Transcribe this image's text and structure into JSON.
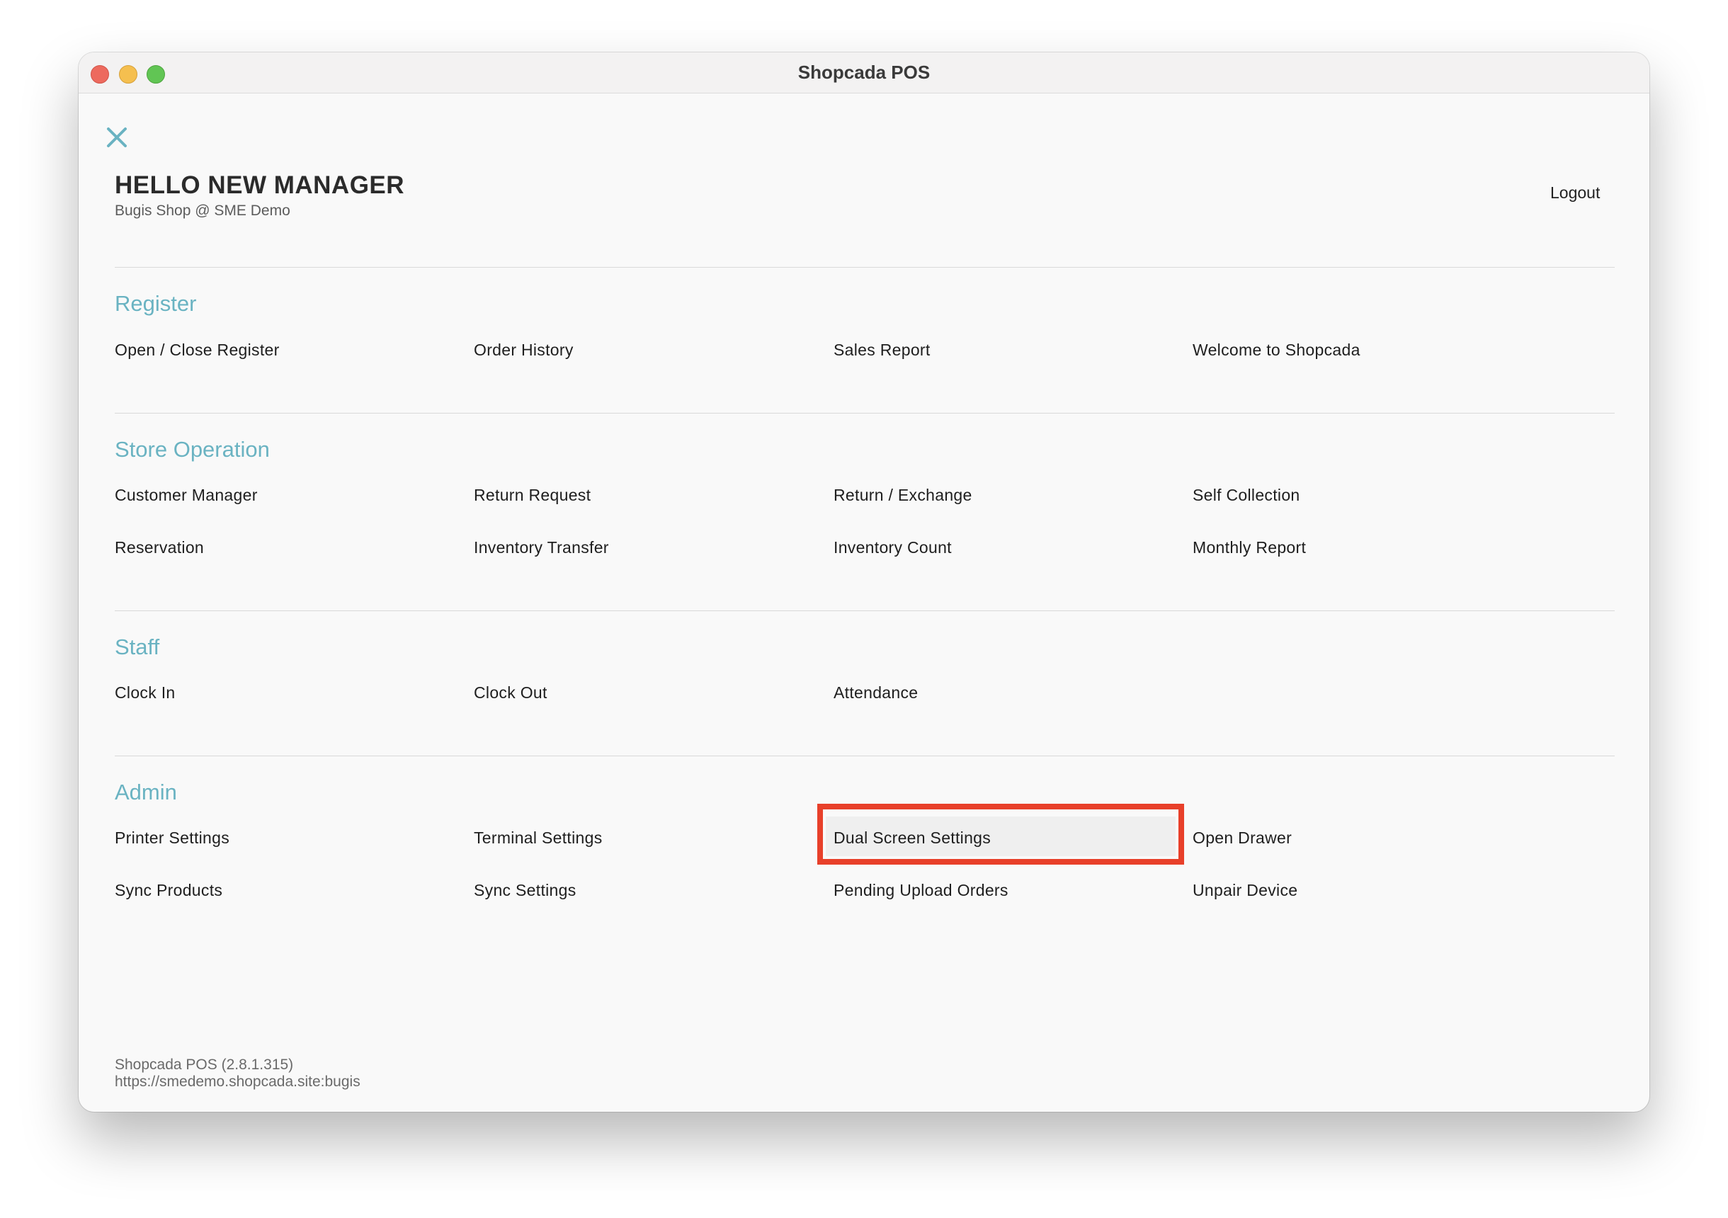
{
  "window": {
    "title": "Shopcada POS"
  },
  "header": {
    "greeting": "HELLO NEW MANAGER",
    "store": "Bugis Shop @ SME Demo",
    "logout_label": "Logout",
    "close_icon": "close-icon"
  },
  "sections": {
    "register": {
      "heading": "Register",
      "items": [
        "Open / Close Register",
        "Order History",
        "Sales Report",
        "Welcome to Shopcada"
      ]
    },
    "store_operation": {
      "heading": "Store Operation",
      "items": [
        "Customer Manager",
        "Return Request",
        "Return / Exchange",
        "Self Collection",
        "Reservation",
        "Inventory Transfer",
        "Inventory Count",
        "Monthly Report"
      ]
    },
    "staff": {
      "heading": "Staff",
      "items": [
        "Clock In",
        "Clock Out",
        "Attendance"
      ]
    },
    "admin": {
      "heading": "Admin",
      "items": [
        "Printer Settings",
        "Terminal Settings",
        "Dual Screen Settings",
        "Open Drawer",
        "Sync Products",
        "Sync Settings",
        "Pending Upload Orders",
        "Unpair Device"
      ]
    }
  },
  "footer": {
    "version": "Shopcada POS (2.8.1.315)",
    "url": "https://smedemo.shopcada.site:bugis"
  },
  "colors": {
    "accent": "#6ab3c2",
    "highlight": "#e8402a"
  }
}
